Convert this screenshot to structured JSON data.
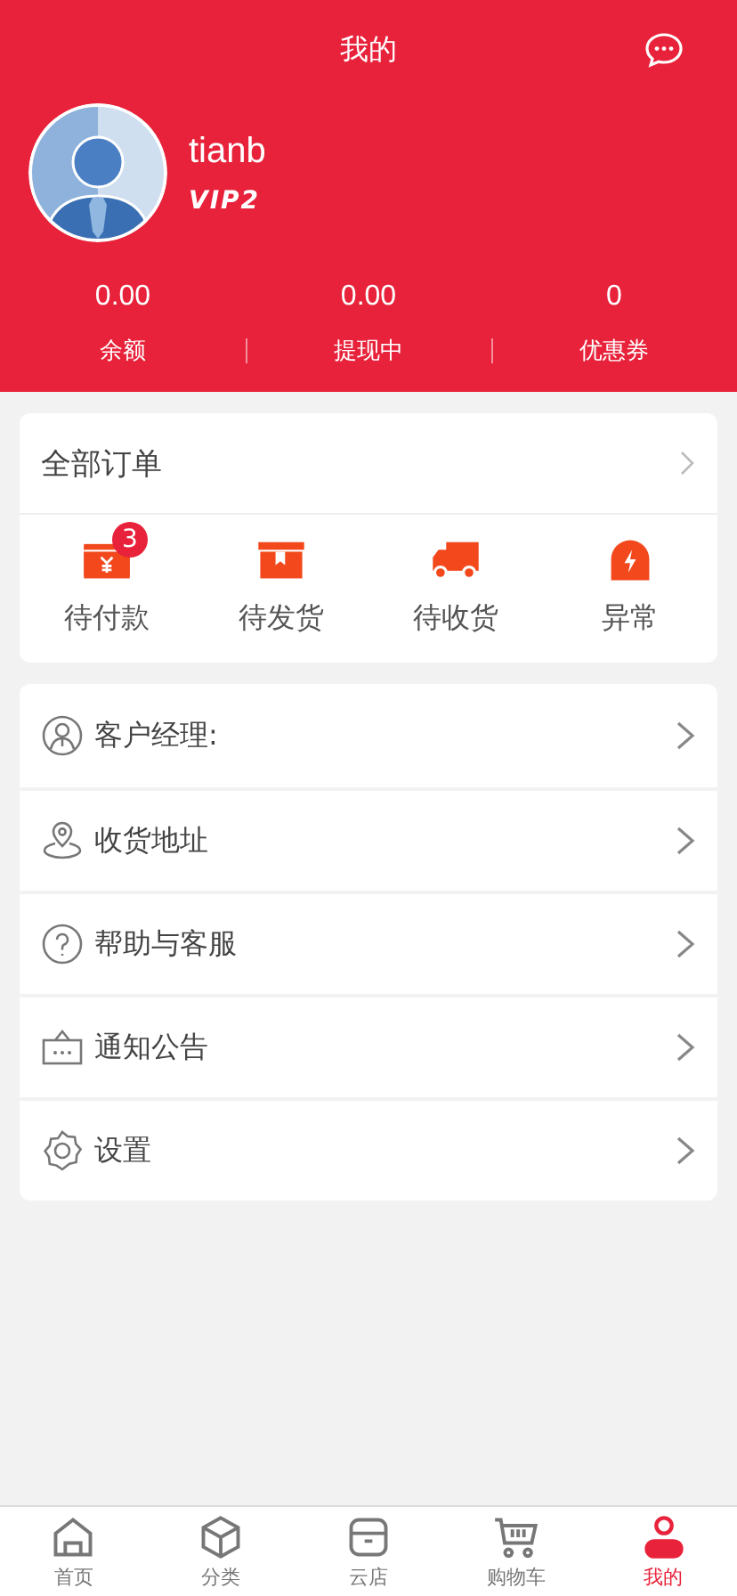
{
  "header": {
    "title": "我的"
  },
  "profile": {
    "name": "tianb",
    "level": "VIP2"
  },
  "stats": [
    {
      "value": "0.00",
      "label": "余额"
    },
    {
      "value": "0.00",
      "label": "提现中"
    },
    {
      "value": "0",
      "label": "优惠券"
    }
  ],
  "orders": {
    "title": "全部订单",
    "items": [
      {
        "kind": "wallet",
        "label": "待付款",
        "badge": "3"
      },
      {
        "kind": "box",
        "label": "待发货"
      },
      {
        "kind": "truck",
        "label": "待收货"
      },
      {
        "kind": "bolt",
        "label": "异常"
      }
    ]
  },
  "menu": [
    {
      "kind": "person",
      "label": "客户经理:"
    },
    {
      "kind": "location",
      "label": "收货地址"
    },
    {
      "kind": "help",
      "label": "帮助与客服"
    },
    {
      "kind": "notice",
      "label": "通知公告"
    },
    {
      "kind": "settings",
      "label": "设置"
    }
  ],
  "tab_bar": [
    {
      "kind": "home",
      "label": "首页",
      "selected": false
    },
    {
      "kind": "cube",
      "label": "分类",
      "selected": false
    },
    {
      "kind": "store",
      "label": "云店",
      "selected": false
    },
    {
      "kind": "cart",
      "label": "购物车",
      "selected": false
    },
    {
      "kind": "me",
      "label": "我的",
      "selected": true
    }
  ]
}
